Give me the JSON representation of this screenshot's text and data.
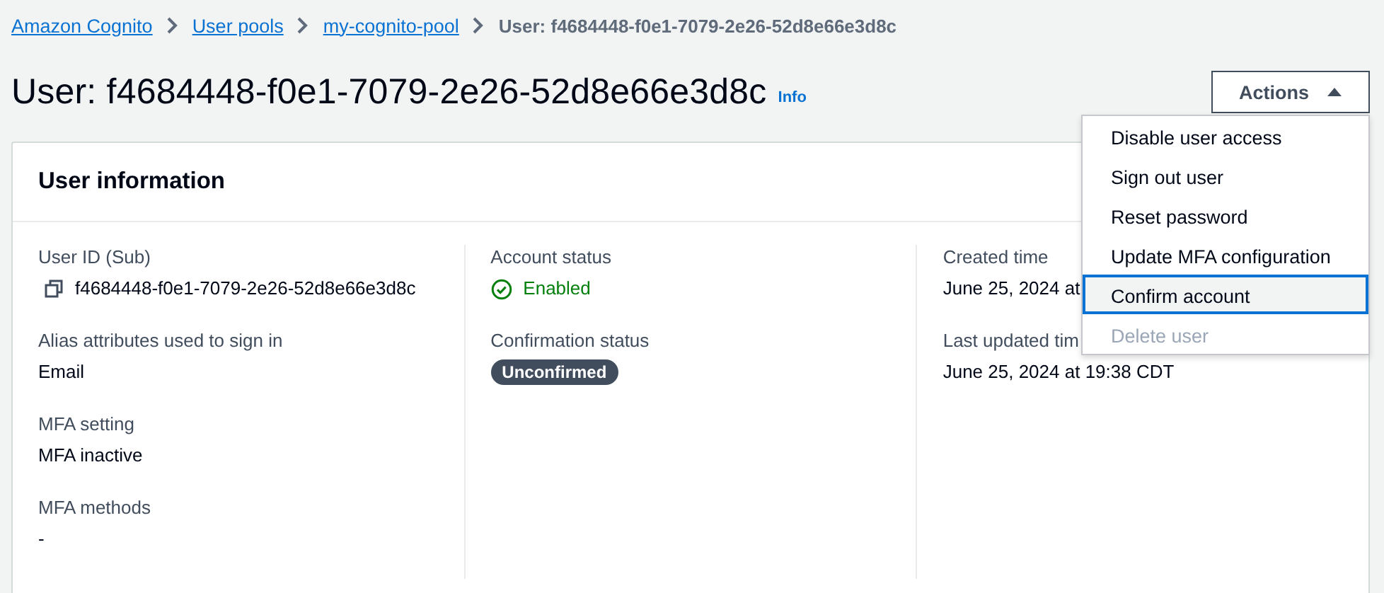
{
  "breadcrumbs": [
    {
      "label": "Amazon Cognito",
      "link": true
    },
    {
      "label": "User pools",
      "link": true
    },
    {
      "label": "my-cognito-pool",
      "link": true
    },
    {
      "label": "User: f4684448-f0e1-7079-2e26-52d8e66e3d8c",
      "link": false
    }
  ],
  "title": "User: f4684448-f0e1-7079-2e26-52d8e66e3d8c",
  "info_link": "Info",
  "actions": {
    "label": "Actions",
    "expanded": true,
    "items": [
      {
        "label": "Disable user access",
        "selected": false,
        "disabled": false
      },
      {
        "label": "Sign out user",
        "selected": false,
        "disabled": false
      },
      {
        "label": "Reset password",
        "selected": false,
        "disabled": false
      },
      {
        "label": "Update MFA configuration",
        "selected": false,
        "disabled": false
      },
      {
        "label": "Confirm account",
        "selected": true,
        "disabled": false
      },
      {
        "label": "Delete user",
        "selected": false,
        "disabled": true
      }
    ]
  },
  "panel": {
    "title": "User information",
    "columns": [
      [
        {
          "label": "User ID (Sub)",
          "value": "f4684448-f0e1-7079-2e26-52d8e66e3d8c",
          "kind": "copy"
        },
        {
          "label": "Alias attributes used to sign in",
          "value": "Email",
          "kind": "text"
        },
        {
          "label": "MFA setting",
          "value": "MFA inactive",
          "kind": "text"
        },
        {
          "label": "MFA methods",
          "value": "-",
          "kind": "text"
        }
      ],
      [
        {
          "label": "Account status",
          "value": "Enabled",
          "kind": "status"
        },
        {
          "label": "Confirmation status",
          "value": "Unconfirmed",
          "kind": "badge"
        }
      ],
      [
        {
          "label": "Created time",
          "value": "June 25, 2024 at",
          "kind": "text"
        },
        {
          "label": "Last updated tim",
          "value": "June 25, 2024 at 19:38 CDT",
          "kind": "text"
        }
      ]
    ]
  }
}
